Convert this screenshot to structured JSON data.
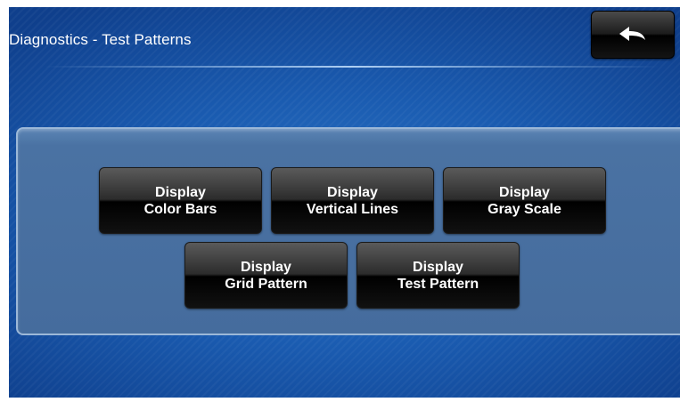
{
  "header": {
    "title": "Diagnostics - Test Patterns",
    "back_icon": "back-arrow-icon"
  },
  "buttons": [
    {
      "line1": "Display",
      "line2": "Color Bars"
    },
    {
      "line1": "Display",
      "line2": "Vertical Lines"
    },
    {
      "line1": "Display",
      "line2": "Gray Scale"
    },
    {
      "line1": "Display",
      "line2": "Grid Pattern"
    },
    {
      "line1": "Display",
      "line2": "Test Pattern"
    }
  ],
  "colors": {
    "background": "#1a5bb0",
    "panel": "#4a72a3",
    "button": "#1c1c1c",
    "text": "#ffffff"
  }
}
